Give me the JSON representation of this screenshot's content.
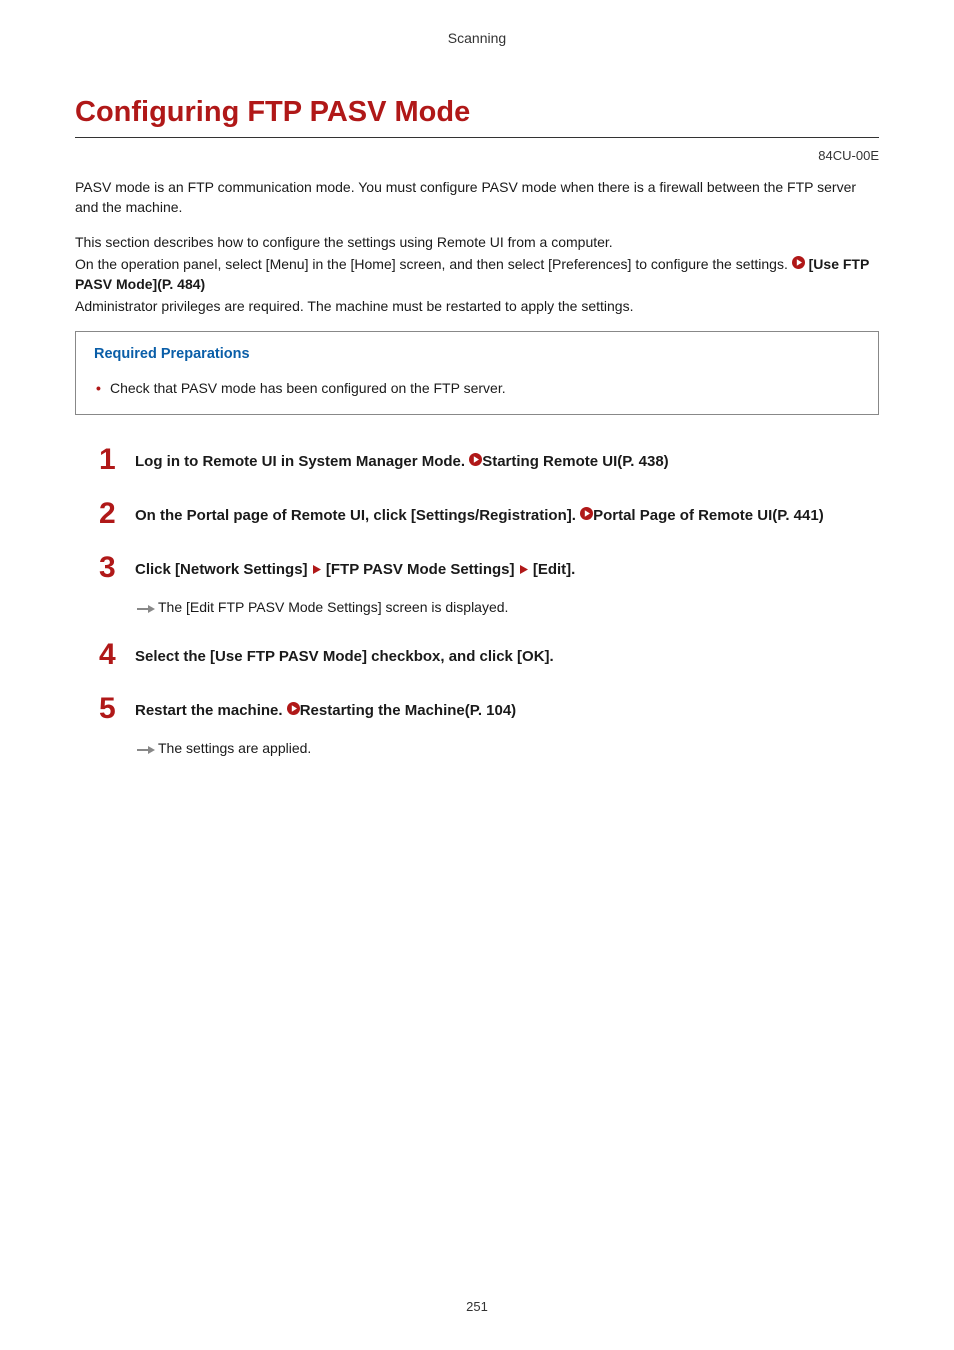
{
  "header": {
    "section": "Scanning"
  },
  "title": "Configuring FTP PASV Mode",
  "doc_code": "84CU-00E",
  "intro": {
    "p1": "PASV mode is an FTP communication mode. You must configure PASV mode when there is a firewall between the FTP server and the machine.",
    "p2a": "This section describes how to configure the settings using Remote UI from a computer.",
    "p2b": "On the operation panel, select [Menu] in the [Home] screen, and then select [Preferences] to configure the settings. ",
    "p2_ref": "[Use FTP PASV Mode](P. 484)",
    "p3": "Administrator privileges are required. The machine must be restarted to apply the settings."
  },
  "prep": {
    "title": "Required Preparations",
    "items": [
      "Check that PASV mode has been configured on the FTP server."
    ]
  },
  "steps": [
    {
      "num": "1",
      "title_a": "Log in to Remote UI in System Manager Mode. ",
      "ref": "Starting Remote UI(P. 438)"
    },
    {
      "num": "2",
      "title_a": "On the Portal page of Remote UI, click [Settings/Registration]. ",
      "ref": "Portal Page of Remote UI(P. 441)"
    },
    {
      "num": "3",
      "title_parts": [
        "Click [Network Settings] ",
        " [FTP PASV Mode Settings] ",
        " [Edit]."
      ],
      "sub": "The [Edit FTP PASV Mode Settings] screen is displayed."
    },
    {
      "num": "4",
      "title_a": "Select the [Use FTP PASV Mode] checkbox, and click [OK]."
    },
    {
      "num": "5",
      "title_a": "Restart the machine. ",
      "ref": "Restarting the Machine(P. 104)",
      "sub": "The settings are applied."
    }
  ],
  "page_number": "251"
}
